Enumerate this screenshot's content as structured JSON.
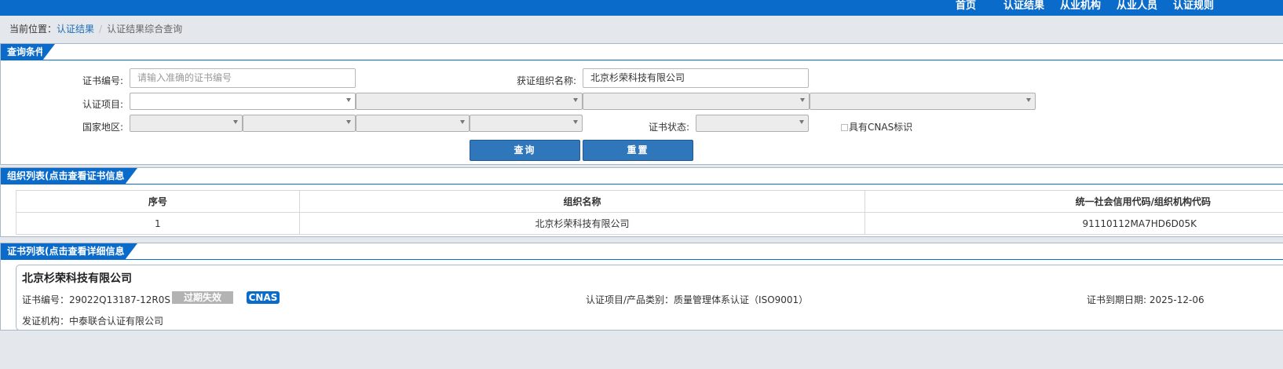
{
  "nav": {
    "items": [
      "首页",
      "认证结果",
      "从业机构",
      "从业人员",
      "认证规则"
    ]
  },
  "breadcrumb": {
    "prefix": "当前位置：",
    "link": "认证结果",
    "separator": "/",
    "current": "认证结果综合查询"
  },
  "query": {
    "title": "查询条件",
    "cert_no_label": "证书编号:",
    "cert_no_placeholder": "请输入准确的证书编号",
    "org_name_label": "获证组织名称:",
    "org_name_value": "北京杉荣科技有限公司",
    "cert_item_label": "认证项目:",
    "region_label": "国家地区:",
    "cert_status_label": "证书状态:",
    "cnas_label": "具有CNAS标识",
    "search_btn": "查询",
    "reset_btn": "重置"
  },
  "org_list": {
    "title": "组织列表(点击查看证书信息)",
    "columns": [
      "序号",
      "组织名称",
      "统一社会信用代码/组织机构代码"
    ],
    "rows": [
      [
        "1",
        "北京杉荣科技有限公司",
        "91110112MA7HD6D05K"
      ]
    ]
  },
  "cert_list": {
    "title": "证书列表(点击查看详细信息)",
    "org_name": "北京杉荣科技有限公司",
    "cert_no": "证书编号：29022Q13187-12R0S",
    "status": "过期失效",
    "cnas": "CNAS",
    "category": "认证项目/产品类别：质量管理体系认证（ISO9001）",
    "expiry": "证书到期日期: 2025-12-06",
    "issuer": "发证机构：中泰联合认证有限公司"
  },
  "colors": {
    "primary": "#0a6bcb",
    "button": "#2f77ba",
    "expired_badge": "#b3b3b3"
  }
}
